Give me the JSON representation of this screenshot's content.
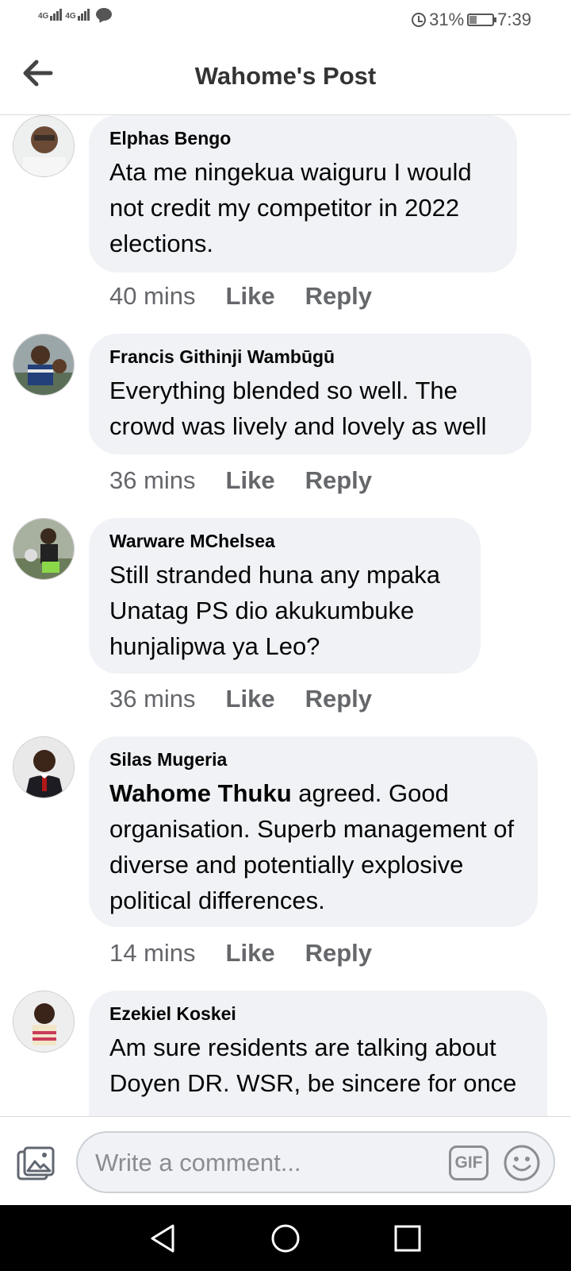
{
  "status_bar": {
    "net1": "4G",
    "net2": "4G",
    "battery_pct": "31%",
    "battery_level": 0.31,
    "time": "7:39"
  },
  "header": {
    "title": "Wahome's Post"
  },
  "comments": [
    {
      "author": "Elphas Bengo",
      "text": "Ata me ningekua waiguru I would not credit my competitor in 2022 elections.",
      "time": "40 mins",
      "like": "Like",
      "reply": "Reply"
    },
    {
      "author": "Francis Githinji Wambūgū",
      "text": "Everything blended so well. The crowd was lively and lovely as well",
      "time": "36 mins",
      "like": "Like",
      "reply": "Reply"
    },
    {
      "author": "Warware MChelsea",
      "text": "Still stranded huna any mpaka Unatag PS dio akukumbuke hunjalipwa ya Leo?",
      "time": "36 mins",
      "like": "Like",
      "reply": "Reply"
    },
    {
      "author": "Silas Mugeria",
      "mention": "Wahome Thuku",
      "text": " agreed. Good organisation. Superb management of diverse and potentially explosive political differences.",
      "time": "14 mins",
      "like": "Like",
      "reply": "Reply"
    },
    {
      "author": "Ezekiel Koskei",
      "text": "Am sure residents are talking about Doyen DR. WSR, be sincere for once"
    }
  ],
  "composer": {
    "placeholder": "Write a comment...",
    "gif_label": "GIF"
  },
  "icons": {
    "back": "arrow-left-icon",
    "gallery": "photo-gallery-icon",
    "gif": "gif-icon",
    "emoji": "smiley-icon",
    "nav_back": "triangle-back-icon",
    "nav_home": "circle-home-icon",
    "nav_recents": "square-recents-icon"
  }
}
